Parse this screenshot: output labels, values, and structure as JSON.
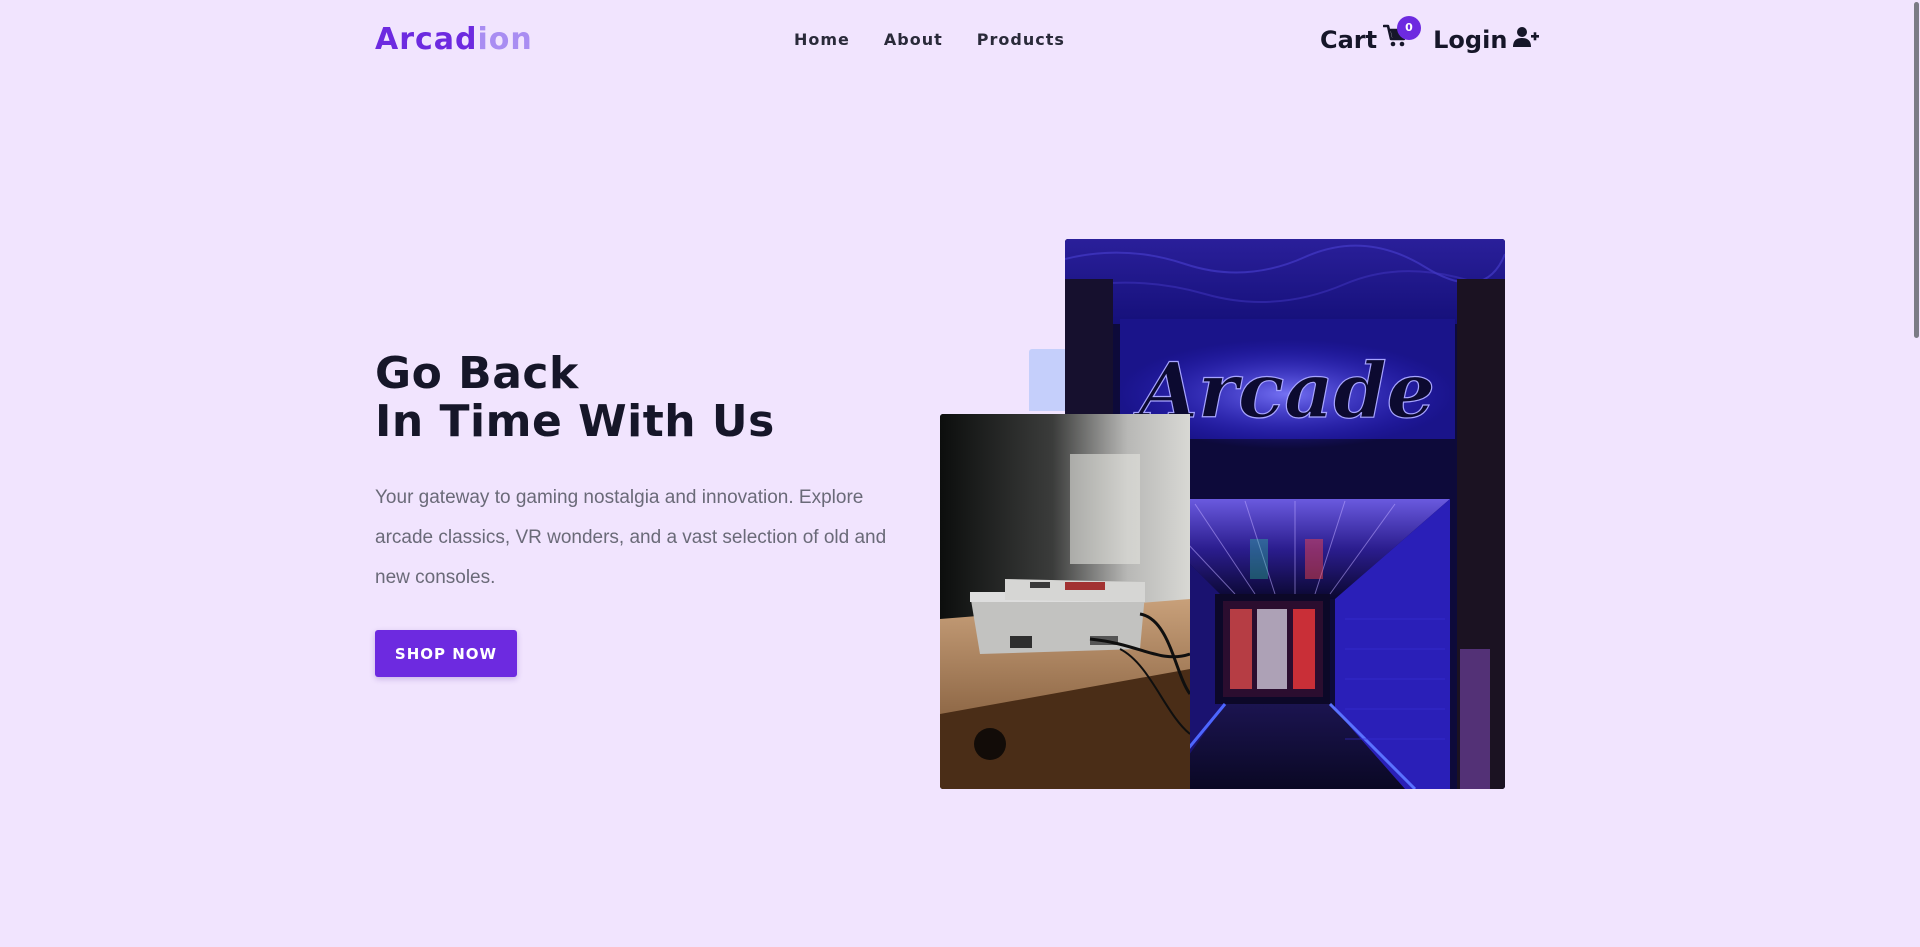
{
  "brand": {
    "name_part1": "Arcad",
    "name_part2": "ion",
    "primary_color": "#6d2ae0",
    "secondary_color": "#a98df2"
  },
  "nav": {
    "links": [
      {
        "label": "Home"
      },
      {
        "label": "About"
      },
      {
        "label": "Products"
      }
    ],
    "cart_label": "Cart",
    "cart_icon": "shopping-cart-icon",
    "cart_count": "0",
    "login_label": "Login",
    "login_icon": "user-plus-icon"
  },
  "hero": {
    "title_line1": "Go Back",
    "title_line2": "In Time With Us",
    "description": "Your gateway to gaming nostalgia and innovation. Explore arcade classics, VR wonders, and a vast selection of old and new consoles.",
    "cta_label": "SHOP NOW"
  },
  "images": {
    "arcade_sign_text": "Arcade"
  },
  "colors": {
    "background": "#f1e4fe",
    "text": "#161629",
    "muted_text": "#6a6a78",
    "accent_block": "#c5cffb"
  }
}
